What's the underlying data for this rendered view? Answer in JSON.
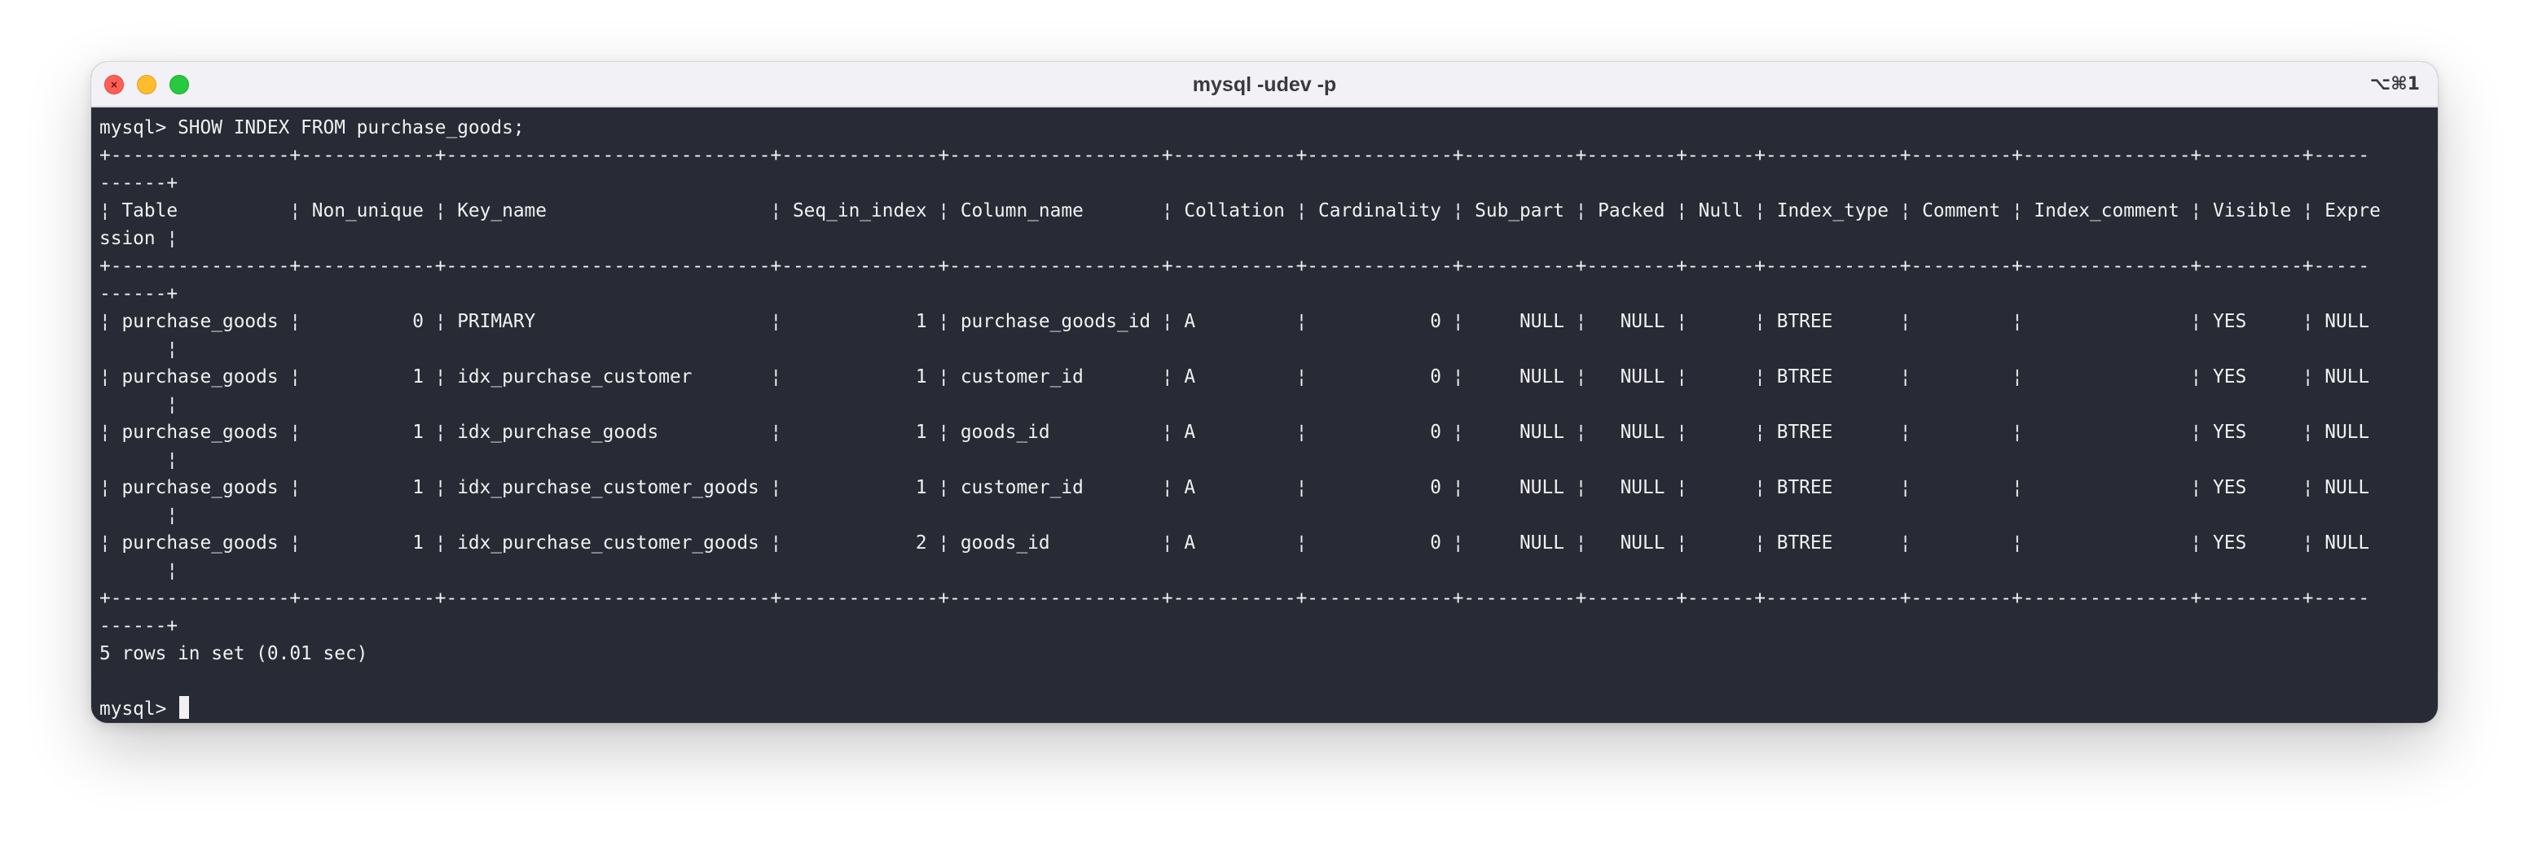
{
  "window": {
    "title": "mysql -udev -p",
    "shortcut": "⌥⌘1"
  },
  "terminal": {
    "prompt": "mysql> ",
    "command": "SHOW INDEX FROM purchase_goods;",
    "lines": [
      "+----------------+------------+-----------------------------+--------------+-------------------+-----------+-------------+----------+--------+------+------------+---------+---------------+---------+-----",
      "------+",
      "¦ Table          ¦ Non_unique ¦ Key_name                    ¦ Seq_in_index ¦ Column_name       ¦ Collation ¦ Cardinality ¦ Sub_part ¦ Packed ¦ Null ¦ Index_type ¦ Comment ¦ Index_comment ¦ Visible ¦ Expre",
      "ssion ¦",
      "+----------------+------------+-----------------------------+--------------+-------------------+-----------+-------------+----------+--------+------+------------+---------+---------------+---------+-----",
      "------+",
      "¦ purchase_goods ¦          0 ¦ PRIMARY                     ¦            1 ¦ purchase_goods_id ¦ A         ¦           0 ¦     NULL ¦   NULL ¦      ¦ BTREE      ¦         ¦               ¦ YES     ¦ NULL",
      "      ¦",
      "¦ purchase_goods ¦          1 ¦ idx_purchase_customer       ¦            1 ¦ customer_id       ¦ A         ¦           0 ¦     NULL ¦   NULL ¦      ¦ BTREE      ¦         ¦               ¦ YES     ¦ NULL",
      "      ¦",
      "¦ purchase_goods ¦          1 ¦ idx_purchase_goods          ¦            1 ¦ goods_id          ¦ A         ¦           0 ¦     NULL ¦   NULL ¦      ¦ BTREE      ¦         ¦               ¦ YES     ¦ NULL",
      "      ¦",
      "¦ purchase_goods ¦          1 ¦ idx_purchase_customer_goods ¦            1 ¦ customer_id       ¦ A         ¦           0 ¦     NULL ¦   NULL ¦      ¦ BTREE      ¦         ¦               ¦ YES     ¦ NULL",
      "      ¦",
      "¦ purchase_goods ¦          1 ¦ idx_purchase_customer_goods ¦            2 ¦ goods_id          ¦ A         ¦           0 ¦     NULL ¦   NULL ¦      ¦ BTREE      ¦         ¦               ¦ YES     ¦ NULL",
      "      ¦",
      "+----------------+------------+-----------------------------+--------------+-------------------+-----------+-------------+----------+--------+------+------------+---------+---------------+---------+-----",
      "------+",
      "5 rows in set (0.01 sec)",
      ""
    ],
    "final_prompt": "mysql> "
  }
}
